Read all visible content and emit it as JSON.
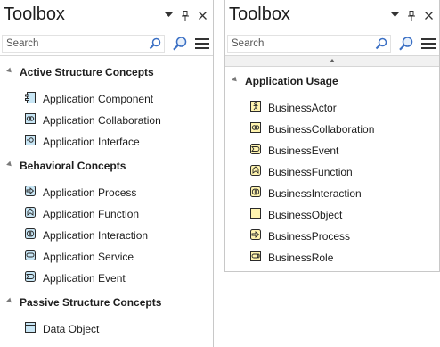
{
  "left_panel": {
    "title": "Toolbox",
    "search_placeholder": "Search",
    "groups": [
      {
        "label": "Active Structure Concepts",
        "items": [
          {
            "label": "Application Component",
            "icon": "app-component-icon"
          },
          {
            "label": "Application Collaboration",
            "icon": "app-collaboration-icon"
          },
          {
            "label": "Application Interface",
            "icon": "app-interface-icon"
          }
        ]
      },
      {
        "label": "Behavioral Concepts",
        "items": [
          {
            "label": "Application Process",
            "icon": "app-process-icon"
          },
          {
            "label": "Application Function",
            "icon": "app-function-icon"
          },
          {
            "label": "Application Interaction",
            "icon": "app-interaction-icon"
          },
          {
            "label": "Application Service",
            "icon": "app-service-icon"
          },
          {
            "label": "Application Event",
            "icon": "app-event-icon"
          }
        ]
      },
      {
        "label": "Passive Structure Concepts",
        "items": [
          {
            "label": "Data Object",
            "icon": "data-object-icon"
          }
        ]
      }
    ]
  },
  "right_panel": {
    "title": "Toolbox",
    "search_placeholder": "Search",
    "groups": [
      {
        "label": "Application Usage",
        "items": [
          {
            "label": "BusinessActor",
            "icon": "business-actor-icon"
          },
          {
            "label": "BusinessCollaboration",
            "icon": "business-collaboration-icon"
          },
          {
            "label": "BusinessEvent",
            "icon": "business-event-icon"
          },
          {
            "label": "BusinessFunction",
            "icon": "business-function-icon"
          },
          {
            "label": "BusinessInteraction",
            "icon": "business-interaction-icon"
          },
          {
            "label": "BusinessObject",
            "icon": "business-object-icon"
          },
          {
            "label": "BusinessProcess",
            "icon": "business-process-icon"
          },
          {
            "label": "BusinessRole",
            "icon": "business-role-icon"
          }
        ]
      }
    ]
  },
  "colors": {
    "application_fill": "#c8e6f5",
    "business_fill": "#fff4b0",
    "icon_stroke": "#2a2a2a",
    "accent_search": "#3a6fc4"
  }
}
